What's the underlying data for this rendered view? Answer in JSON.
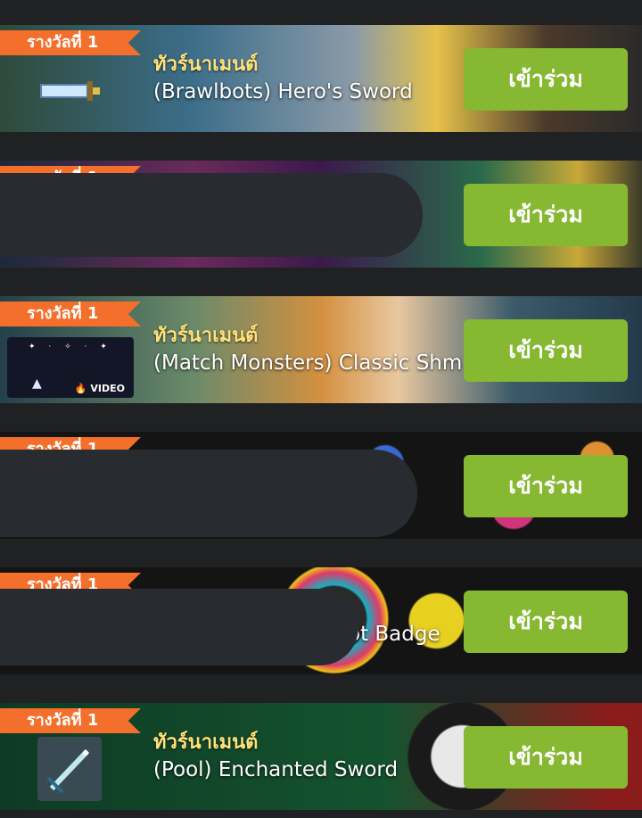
{
  "prize_ribbon": "รางวัลที่ 1",
  "join_label": "เข้าร่วม",
  "tournament_label": "ทัวร์นาเมนต์",
  "video_label": "VIDEO",
  "tournaments": [
    {
      "name": "(Brawlbots) Hero's Sword"
    },
    {
      "name": ""
    },
    {
      "name": "(Match Monsters) Classic Shm"
    },
    {
      "name": ""
    },
    {
      "name": "ot Badge"
    },
    {
      "name": "(Pool) Enchanted Sword"
    }
  ]
}
